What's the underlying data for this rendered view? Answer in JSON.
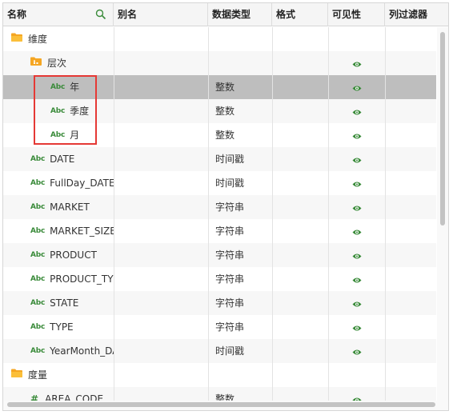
{
  "columns": {
    "name": "名称",
    "alias": "别名",
    "data_type": "数据类型",
    "format": "格式",
    "visibility": "可见性",
    "column_filter": "列过滤器"
  },
  "rows": [
    {
      "kind": "folder",
      "label": "维度",
      "type": "",
      "visible": false
    },
    {
      "kind": "folder",
      "label": "层次",
      "type": "",
      "visible": true
    },
    {
      "kind": "abc",
      "abc": "Abc",
      "label": "年",
      "type": "整数",
      "visible": true,
      "selected": true
    },
    {
      "kind": "abc",
      "abc": "Abc",
      "label": "季度",
      "type": "整数",
      "visible": true
    },
    {
      "kind": "abc",
      "abc": "Abc",
      "label": "月",
      "type": "整数",
      "visible": true
    },
    {
      "kind": "abc",
      "abc": "Abc",
      "label": "DATE",
      "type": "时间戳",
      "visible": true
    },
    {
      "kind": "abc",
      "abc": "Abc",
      "label": "FullDay_DATE",
      "type": "时间戳",
      "visible": true
    },
    {
      "kind": "abc",
      "abc": "Abc",
      "label": "MARKET",
      "type": "字符串",
      "visible": true
    },
    {
      "kind": "abc",
      "abc": "Abc",
      "label": "MARKET_SIZE",
      "type": "字符串",
      "visible": true
    },
    {
      "kind": "abc",
      "abc": "Abc",
      "label": "PRODUCT",
      "type": "字符串",
      "visible": true
    },
    {
      "kind": "abc",
      "abc": "Abc",
      "label": "PRODUCT_TYPE",
      "type": "字符串",
      "visible": true
    },
    {
      "kind": "abc",
      "abc": "Abc",
      "label": "STATE",
      "type": "字符串",
      "visible": true
    },
    {
      "kind": "abc",
      "abc": "Abc",
      "label": "TYPE",
      "type": "字符串",
      "visible": true
    },
    {
      "kind": "abc",
      "abc": "Abc",
      "label": "YearMonth_DATE",
      "type": "时间戳",
      "visible": true
    },
    {
      "kind": "folder",
      "label": "度量",
      "type": "",
      "visible": false
    },
    {
      "kind": "hash",
      "abc": "#",
      "label": "AREA_CODE",
      "type": "整数",
      "visible": true
    }
  ],
  "colors": {
    "accent_green": "#3a8b3a",
    "folder_orange": "#f5a623",
    "selection": "#bebebe",
    "highlight_red": "#e53935"
  }
}
